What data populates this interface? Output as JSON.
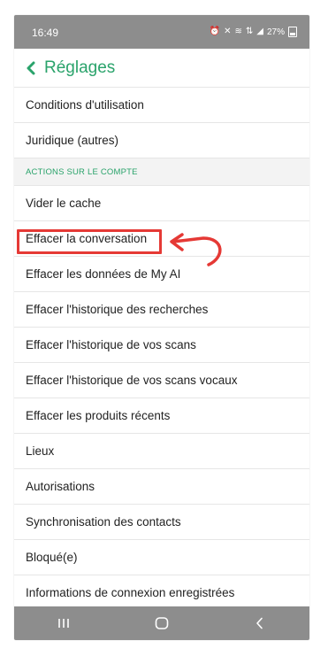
{
  "status_bar": {
    "time": "16:49",
    "battery": "27%",
    "icons": [
      "alarm-icon",
      "mute-icon",
      "vowifi-icon",
      "lte-icon",
      "signal-icon",
      "battery-icon"
    ]
  },
  "header": {
    "title": "Réglages"
  },
  "settings": {
    "rows_top": [
      {
        "label": "Conditions d'utilisation"
      },
      {
        "label": "Juridique (autres)"
      }
    ],
    "section_title": "ACTIONS SUR LE COMPTE",
    "rows": [
      {
        "label": "Vider le cache"
      },
      {
        "label": "Effacer la conversation"
      },
      {
        "label": "Effacer les données de My AI"
      },
      {
        "label": "Effacer l'historique des recherches"
      },
      {
        "label": "Effacer l'historique de vos scans"
      },
      {
        "label": "Effacer l'historique de vos scans vocaux"
      },
      {
        "label": "Effacer les produits récents"
      },
      {
        "label": "Lieux"
      },
      {
        "label": "Autorisations"
      },
      {
        "label": "Synchronisation des contacts"
      },
      {
        "label": "Bloqué(e)"
      },
      {
        "label": "Informations de connexion enregistrées"
      }
    ]
  },
  "nav_bar": {
    "icons": [
      "recent-apps-icon",
      "home-icon",
      "back-nav-icon"
    ]
  },
  "colors": {
    "accent": "#2aa36b",
    "highlight": "#e53935",
    "bars": "#8d8d8d"
  }
}
